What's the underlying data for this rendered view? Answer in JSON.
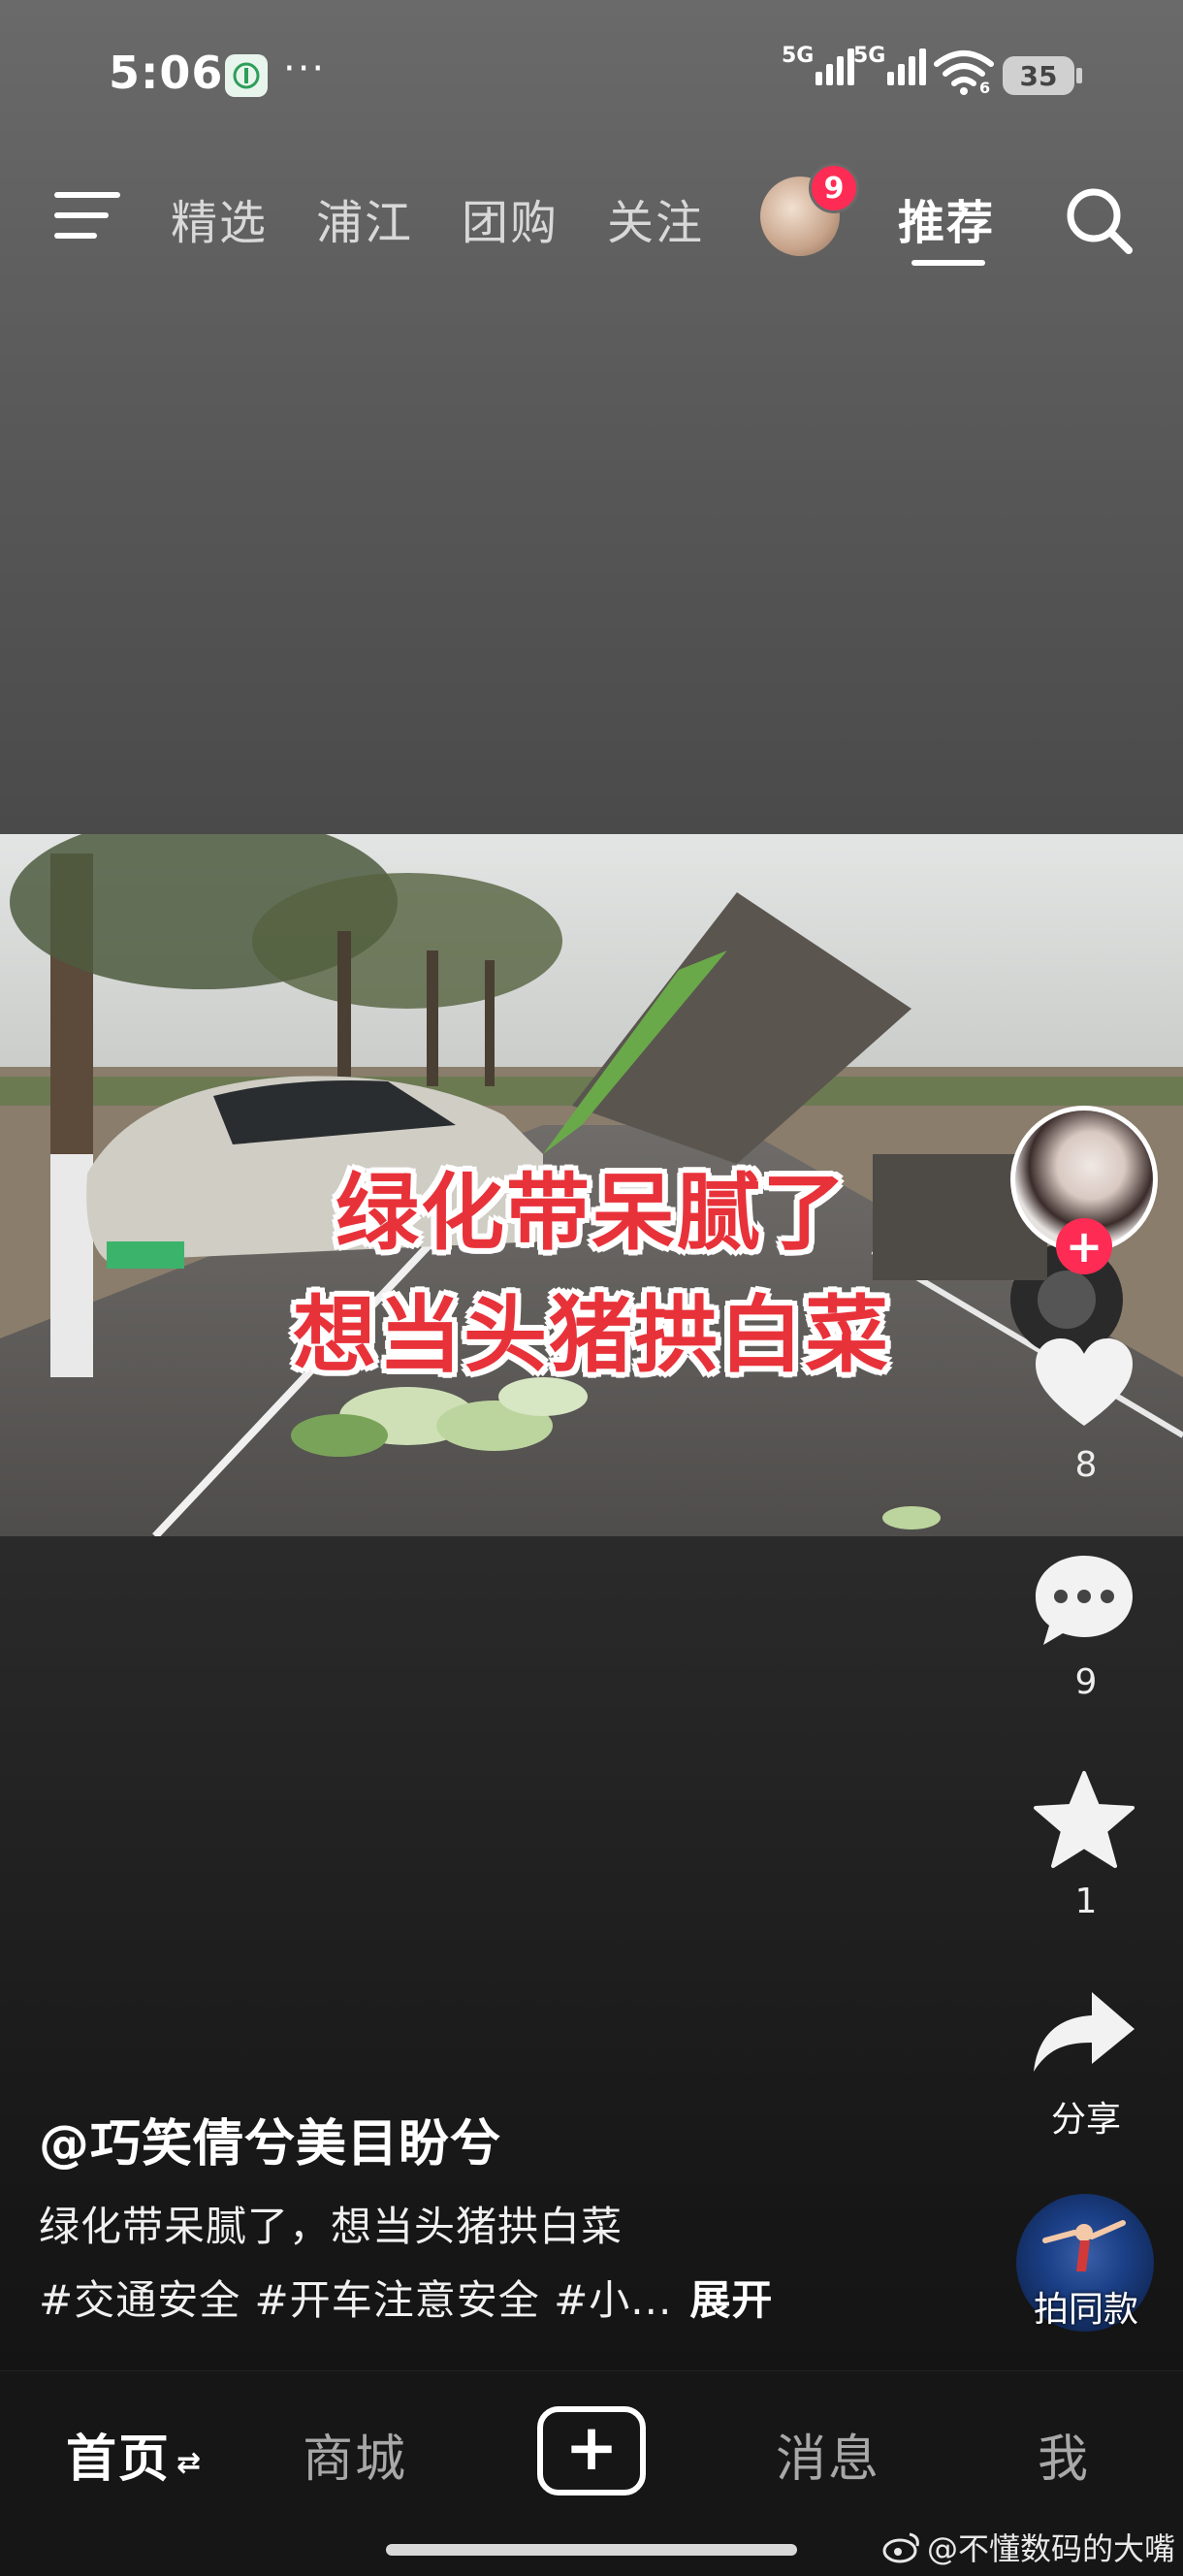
{
  "status_bar": {
    "time": "5:06",
    "more": "···",
    "signal1_label": "5G",
    "signal2_label": "5G",
    "wifi_label": "6",
    "battery": "35"
  },
  "top_nav": {
    "tabs": [
      "精选",
      "浦江",
      "团购",
      "关注",
      "推荐"
    ],
    "active_tab": "推荐",
    "avatar_badge": "9"
  },
  "video": {
    "caption_line1": "绿化带呆腻了",
    "caption_line2": "想当头猪拱白菜"
  },
  "actions": {
    "follow": "+",
    "likes": "8",
    "comments": "9",
    "favorites": "1",
    "share_label": "分享",
    "remix_label": "拍同款"
  },
  "post": {
    "author": "@巧笑倩兮美目盼兮",
    "description": "绿化带呆腻了，想当头猪拱白菜",
    "tags": "#交通安全 #开车注意安全 #小...",
    "expand": "展开"
  },
  "tabbar": {
    "home": "首页",
    "home_swap": "⇄",
    "mall": "商城",
    "plus": "+",
    "messages": "消息",
    "me": "我"
  },
  "watermark": "@不懂数码的大嘴"
}
